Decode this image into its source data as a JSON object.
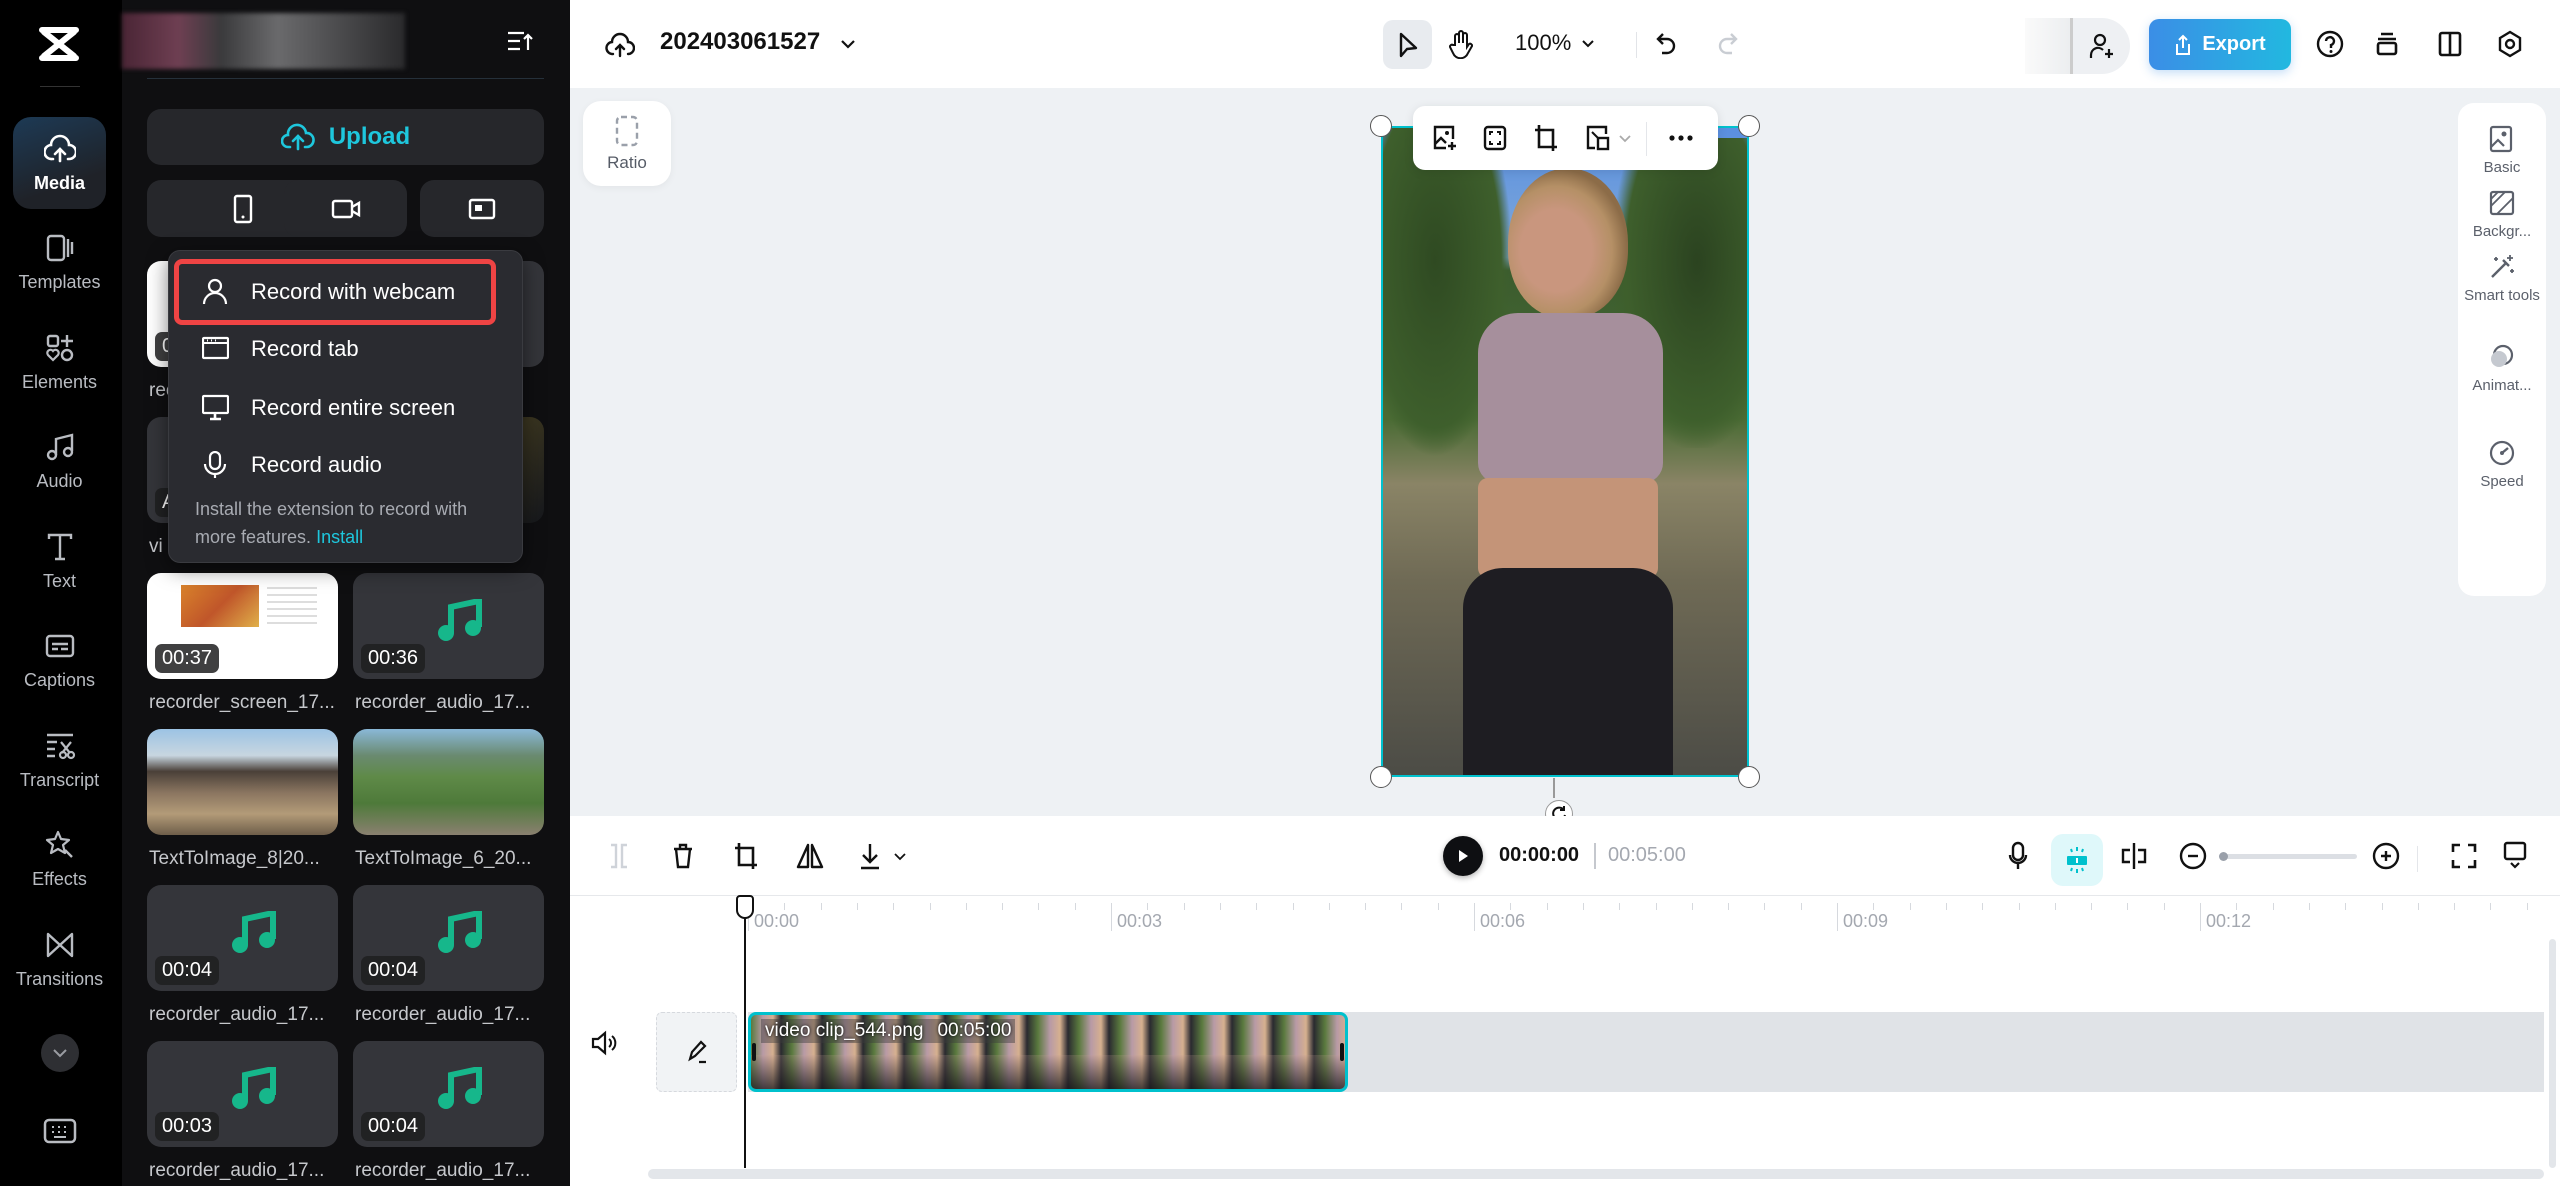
{
  "nav": {
    "items": [
      {
        "label": "Media",
        "icon": "cloud-upload-icon",
        "active": true
      },
      {
        "label": "Templates",
        "icon": "templates-icon"
      },
      {
        "label": "Elements",
        "icon": "elements-icon"
      },
      {
        "label": "Audio",
        "icon": "music-note-icon"
      },
      {
        "label": "Text",
        "icon": "text-icon"
      },
      {
        "label": "Captions",
        "icon": "captions-icon"
      },
      {
        "label": "Transcript",
        "icon": "transcript-icon"
      },
      {
        "label": "Effects",
        "icon": "effects-icon"
      },
      {
        "label": "Transitions",
        "icon": "transitions-icon"
      }
    ]
  },
  "panel": {
    "upload_label": "Upload",
    "media": [
      {
        "name": "rec",
        "duration": "0",
        "type": "screen"
      },
      {
        "name": "",
        "duration": "",
        "type": "audio"
      },
      {
        "name": "vi",
        "duration": "A",
        "type": "video"
      },
      {
        "name": "",
        "duration": "",
        "type": "night"
      },
      {
        "name": "recorder_screen_17...",
        "duration": "00:37",
        "type": "screen"
      },
      {
        "name": "recorder_audio_17...",
        "duration": "00:36",
        "type": "audio"
      },
      {
        "name": "TextToImage_8|20...",
        "duration": "",
        "type": "game1"
      },
      {
        "name": "TextToImage_6_20...",
        "duration": "",
        "type": "game2"
      },
      {
        "name": "recorder_audio_17...",
        "duration": "00:04",
        "type": "audio"
      },
      {
        "name": "recorder_audio_17...",
        "duration": "00:04",
        "type": "audio"
      },
      {
        "name": "recorder_audio_17...",
        "duration": "00:03",
        "type": "audio"
      },
      {
        "name": "recorder_audio_17...",
        "duration": "00:04",
        "type": "audio"
      }
    ]
  },
  "record_menu": {
    "items": [
      {
        "label": "Record with webcam",
        "icon": "person-icon",
        "highlighted": true
      },
      {
        "label": "Record tab",
        "icon": "browser-tab-icon"
      },
      {
        "label": "Record entire screen",
        "icon": "monitor-icon"
      },
      {
        "label": "Record audio",
        "icon": "microphone-icon"
      }
    ],
    "footer_text": "Install the extension to record with more features.",
    "footer_link": "Install"
  },
  "topbar": {
    "project_title": "202403061527",
    "zoom": "100%",
    "export_label": "Export"
  },
  "canvas": {
    "ratio_label": "Ratio"
  },
  "right_panel": {
    "items": [
      {
        "label": "Basic",
        "icon": "image-icon"
      },
      {
        "label": "Backgr...",
        "icon": "background-icon"
      },
      {
        "label": "Smart tools",
        "icon": "magic-wand-icon"
      },
      {
        "label": "Animat...",
        "icon": "animation-icon"
      },
      {
        "label": "Speed",
        "icon": "speedometer-icon"
      }
    ]
  },
  "timeline": {
    "current_time": "00:00:00",
    "total_time": "00:05:00",
    "ruler_labels": [
      "00:00",
      "00:03",
      "00:06",
      "00:09",
      "00:12"
    ],
    "clip": {
      "name": "video clip_544.png",
      "duration": "00:05:00"
    },
    "zoom_level": 0.0
  },
  "colors": {
    "accent": "#00c1cd",
    "export_start": "#3b8ee6",
    "export_end": "#22b8e0",
    "audio_note": "#16b78b",
    "menu_highlight": "#ef4444"
  }
}
